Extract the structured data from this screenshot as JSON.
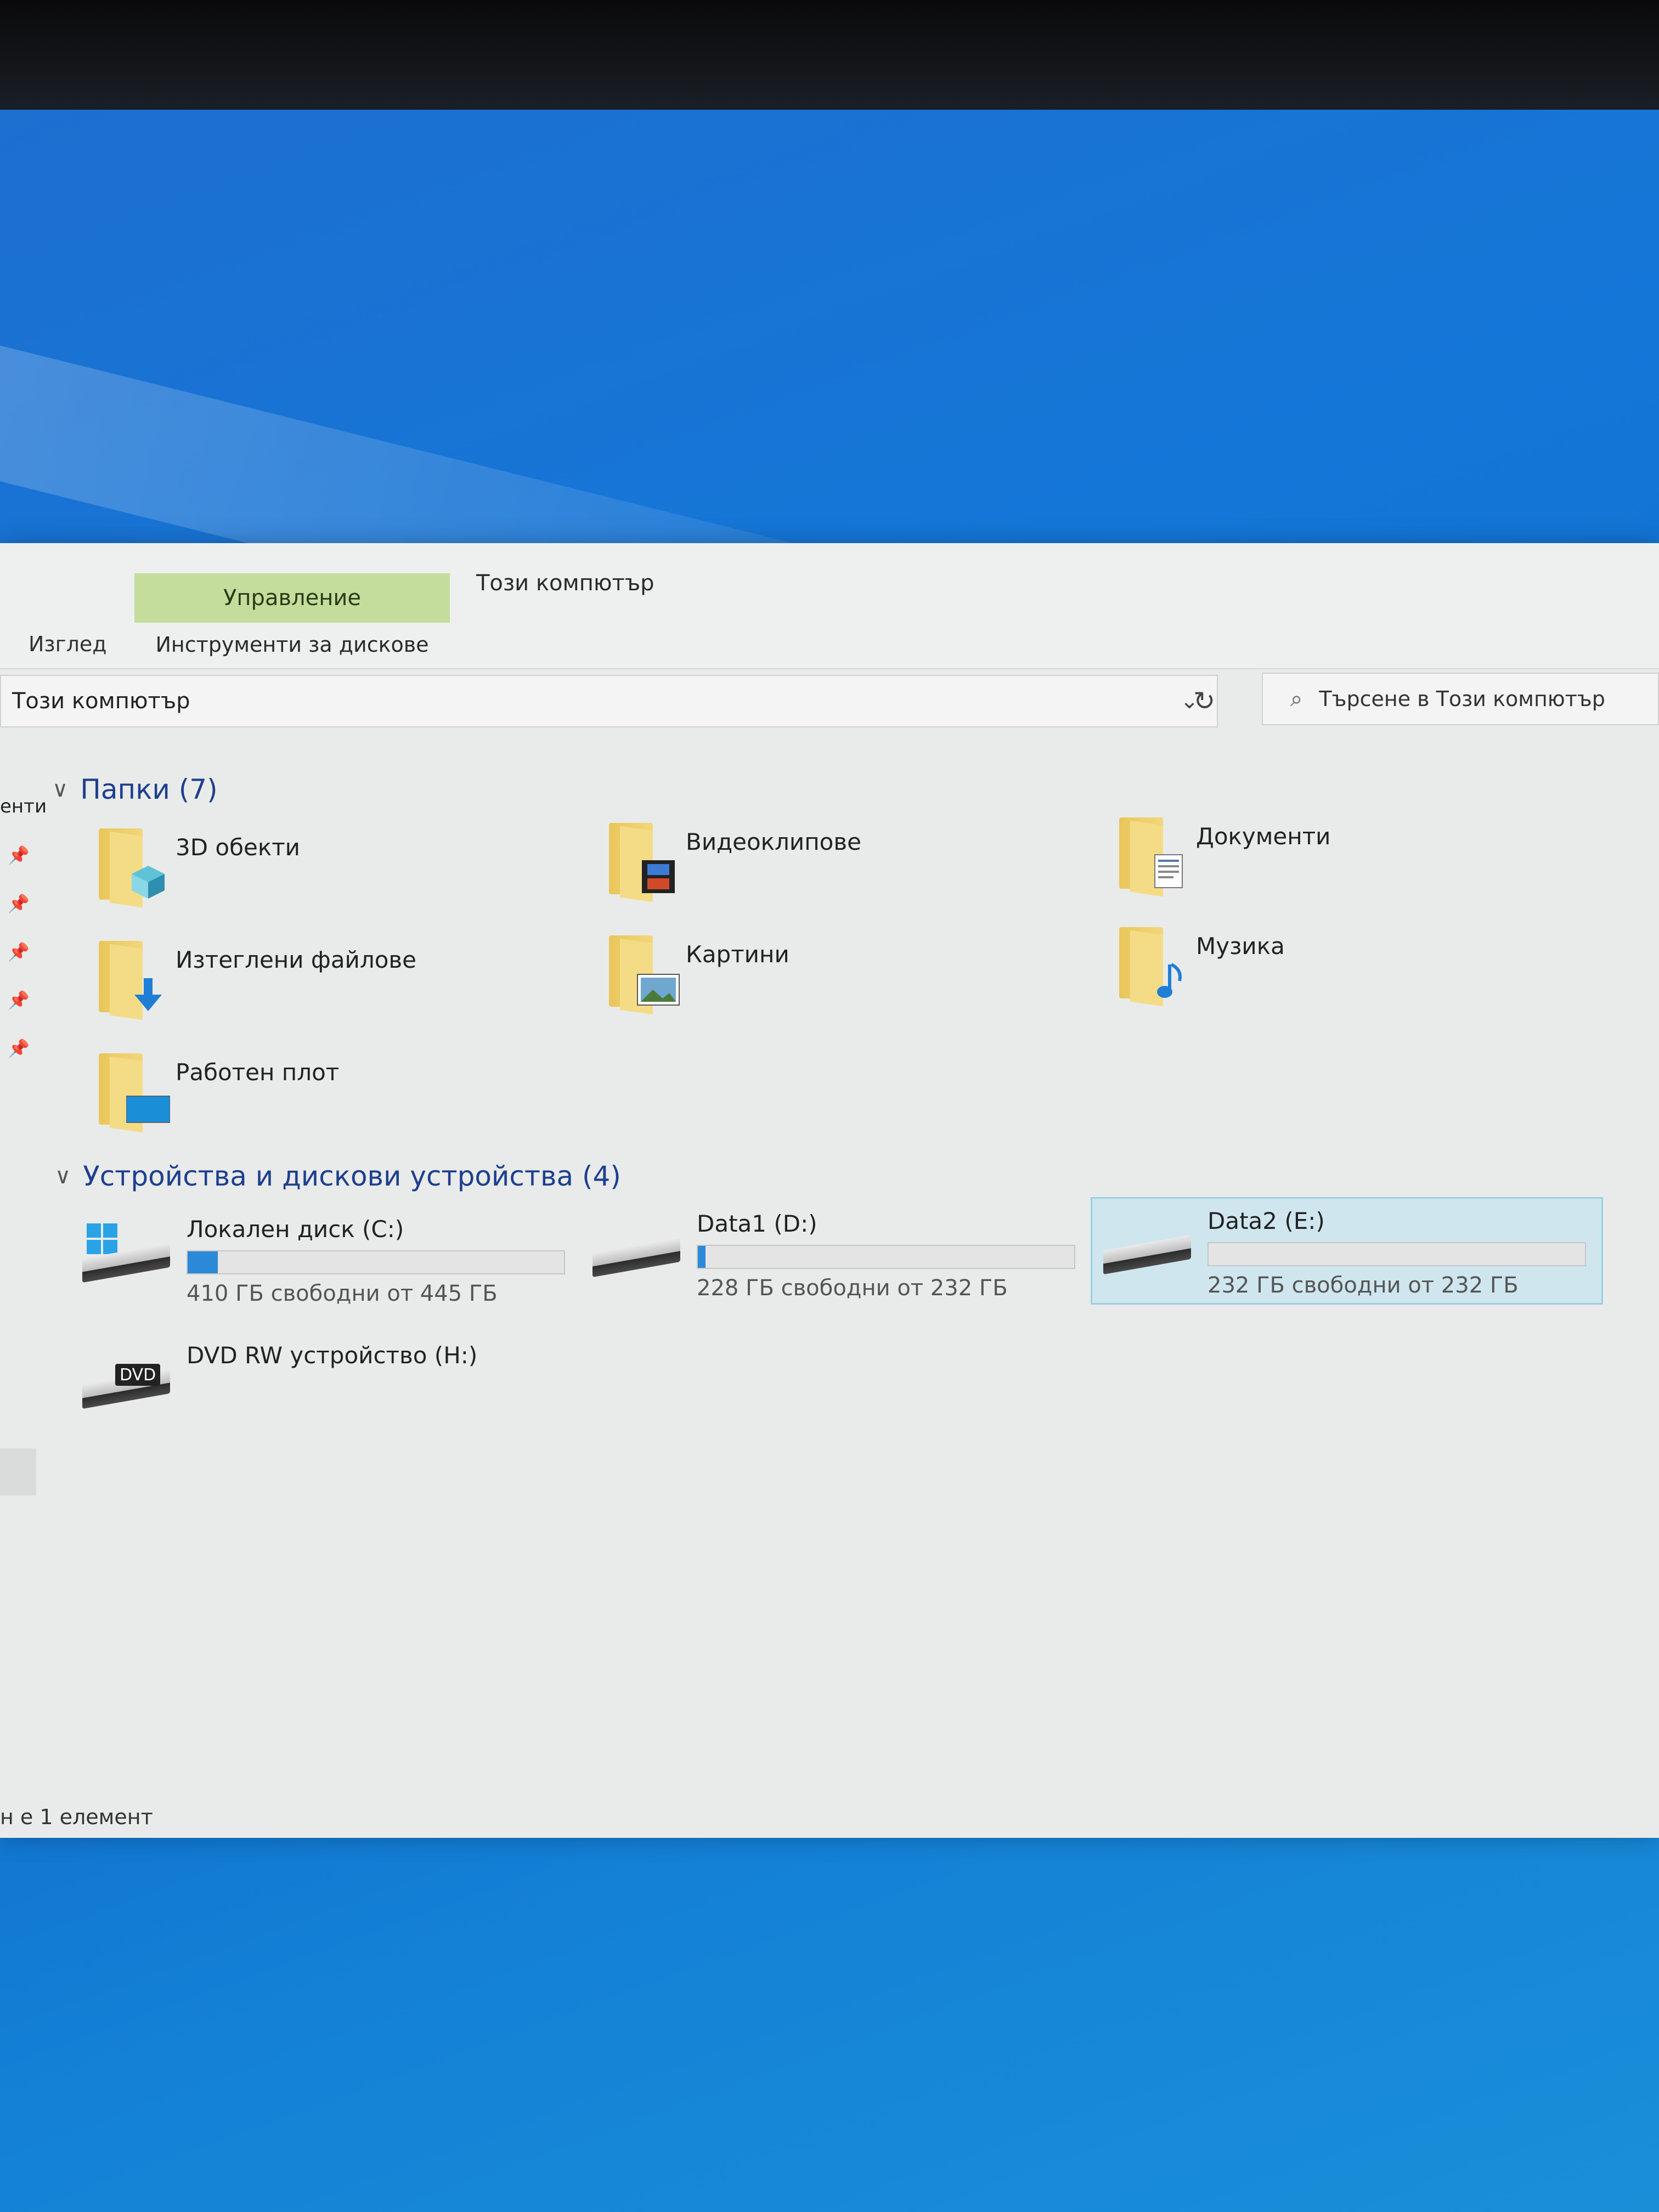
{
  "ribbon": {
    "manage_tab": "Управление",
    "context_title": "Този компютър",
    "view_tab": "Изглед",
    "disk_tools_tab": "Инструменти за дискове"
  },
  "address": {
    "path": "Този компютър",
    "dropdown_icon": "chevron-down-icon",
    "refresh_icon": "refresh-icon"
  },
  "search": {
    "placeholder": "Търсене в Този компютър",
    "icon": "search-icon"
  },
  "nav": {
    "partial_label": "енти"
  },
  "folders": {
    "header": "Папки (7)",
    "items": [
      {
        "label": "3D обекти",
        "icon": "3d-objects-folder-icon"
      },
      {
        "label": "Видеоклипове",
        "icon": "videos-folder-icon"
      },
      {
        "label": "Документи",
        "icon": "documents-folder-icon"
      },
      {
        "label": "Изтеглени файлове",
        "icon": "downloads-folder-icon"
      },
      {
        "label": "Картини",
        "icon": "pictures-folder-icon"
      },
      {
        "label": "Музика",
        "icon": "music-folder-icon"
      },
      {
        "label": "Работен плот",
        "icon": "desktop-folder-icon"
      }
    ]
  },
  "drives": {
    "header": "Устройства и дискови устройства (4)",
    "items": [
      {
        "name": "Локален диск (C:)",
        "free": "410 ГБ свободни от 445 ГБ",
        "used_fraction": 0.08,
        "icon": "system-drive-icon"
      },
      {
        "name": "Data1 (D:)",
        "free": "228 ГБ свободни от 232 ГБ",
        "used_fraction": 0.02,
        "icon": "hard-drive-icon"
      },
      {
        "name": "Data2 (E:)",
        "free": "232 ГБ свободни от 232 ГБ",
        "used_fraction": 0.0,
        "icon": "hard-drive-icon",
        "selected": true
      },
      {
        "name": "DVD RW устройство (H:)",
        "badge": "DVD",
        "icon": "dvd-drive-icon"
      }
    ]
  },
  "status": {
    "text": "н е 1 елемент"
  },
  "colors": {
    "manage_tab_bg": "#c5dd9c",
    "group_header": "#1d3f8f",
    "usage_fill": "#2b89d8",
    "selection_bg": "#cfe6ef"
  }
}
